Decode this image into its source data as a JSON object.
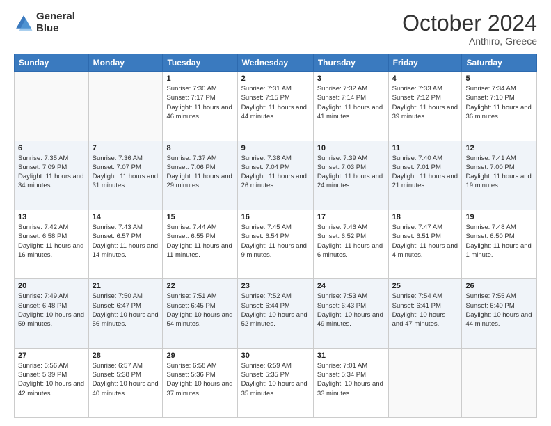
{
  "header": {
    "logo_line1": "General",
    "logo_line2": "Blue",
    "title": "October 2024",
    "subtitle": "Anthiro, Greece"
  },
  "days_of_week": [
    "Sunday",
    "Monday",
    "Tuesday",
    "Wednesday",
    "Thursday",
    "Friday",
    "Saturday"
  ],
  "weeks": [
    [
      {
        "num": "",
        "info": ""
      },
      {
        "num": "",
        "info": ""
      },
      {
        "num": "1",
        "info": "Sunrise: 7:30 AM\nSunset: 7:17 PM\nDaylight: 11 hours and 46 minutes."
      },
      {
        "num": "2",
        "info": "Sunrise: 7:31 AM\nSunset: 7:15 PM\nDaylight: 11 hours and 44 minutes."
      },
      {
        "num": "3",
        "info": "Sunrise: 7:32 AM\nSunset: 7:14 PM\nDaylight: 11 hours and 41 minutes."
      },
      {
        "num": "4",
        "info": "Sunrise: 7:33 AM\nSunset: 7:12 PM\nDaylight: 11 hours and 39 minutes."
      },
      {
        "num": "5",
        "info": "Sunrise: 7:34 AM\nSunset: 7:10 PM\nDaylight: 11 hours and 36 minutes."
      }
    ],
    [
      {
        "num": "6",
        "info": "Sunrise: 7:35 AM\nSunset: 7:09 PM\nDaylight: 11 hours and 34 minutes."
      },
      {
        "num": "7",
        "info": "Sunrise: 7:36 AM\nSunset: 7:07 PM\nDaylight: 11 hours and 31 minutes."
      },
      {
        "num": "8",
        "info": "Sunrise: 7:37 AM\nSunset: 7:06 PM\nDaylight: 11 hours and 29 minutes."
      },
      {
        "num": "9",
        "info": "Sunrise: 7:38 AM\nSunset: 7:04 PM\nDaylight: 11 hours and 26 minutes."
      },
      {
        "num": "10",
        "info": "Sunrise: 7:39 AM\nSunset: 7:03 PM\nDaylight: 11 hours and 24 minutes."
      },
      {
        "num": "11",
        "info": "Sunrise: 7:40 AM\nSunset: 7:01 PM\nDaylight: 11 hours and 21 minutes."
      },
      {
        "num": "12",
        "info": "Sunrise: 7:41 AM\nSunset: 7:00 PM\nDaylight: 11 hours and 19 minutes."
      }
    ],
    [
      {
        "num": "13",
        "info": "Sunrise: 7:42 AM\nSunset: 6:58 PM\nDaylight: 11 hours and 16 minutes."
      },
      {
        "num": "14",
        "info": "Sunrise: 7:43 AM\nSunset: 6:57 PM\nDaylight: 11 hours and 14 minutes."
      },
      {
        "num": "15",
        "info": "Sunrise: 7:44 AM\nSunset: 6:55 PM\nDaylight: 11 hours and 11 minutes."
      },
      {
        "num": "16",
        "info": "Sunrise: 7:45 AM\nSunset: 6:54 PM\nDaylight: 11 hours and 9 minutes."
      },
      {
        "num": "17",
        "info": "Sunrise: 7:46 AM\nSunset: 6:52 PM\nDaylight: 11 hours and 6 minutes."
      },
      {
        "num": "18",
        "info": "Sunrise: 7:47 AM\nSunset: 6:51 PM\nDaylight: 11 hours and 4 minutes."
      },
      {
        "num": "19",
        "info": "Sunrise: 7:48 AM\nSunset: 6:50 PM\nDaylight: 11 hours and 1 minute."
      }
    ],
    [
      {
        "num": "20",
        "info": "Sunrise: 7:49 AM\nSunset: 6:48 PM\nDaylight: 10 hours and 59 minutes."
      },
      {
        "num": "21",
        "info": "Sunrise: 7:50 AM\nSunset: 6:47 PM\nDaylight: 10 hours and 56 minutes."
      },
      {
        "num": "22",
        "info": "Sunrise: 7:51 AM\nSunset: 6:45 PM\nDaylight: 10 hours and 54 minutes."
      },
      {
        "num": "23",
        "info": "Sunrise: 7:52 AM\nSunset: 6:44 PM\nDaylight: 10 hours and 52 minutes."
      },
      {
        "num": "24",
        "info": "Sunrise: 7:53 AM\nSunset: 6:43 PM\nDaylight: 10 hours and 49 minutes."
      },
      {
        "num": "25",
        "info": "Sunrise: 7:54 AM\nSunset: 6:41 PM\nDaylight: 10 hours and 47 minutes."
      },
      {
        "num": "26",
        "info": "Sunrise: 7:55 AM\nSunset: 6:40 PM\nDaylight: 10 hours and 44 minutes."
      }
    ],
    [
      {
        "num": "27",
        "info": "Sunrise: 6:56 AM\nSunset: 5:39 PM\nDaylight: 10 hours and 42 minutes."
      },
      {
        "num": "28",
        "info": "Sunrise: 6:57 AM\nSunset: 5:38 PM\nDaylight: 10 hours and 40 minutes."
      },
      {
        "num": "29",
        "info": "Sunrise: 6:58 AM\nSunset: 5:36 PM\nDaylight: 10 hours and 37 minutes."
      },
      {
        "num": "30",
        "info": "Sunrise: 6:59 AM\nSunset: 5:35 PM\nDaylight: 10 hours and 35 minutes."
      },
      {
        "num": "31",
        "info": "Sunrise: 7:01 AM\nSunset: 5:34 PM\nDaylight: 10 hours and 33 minutes."
      },
      {
        "num": "",
        "info": ""
      },
      {
        "num": "",
        "info": ""
      }
    ]
  ]
}
